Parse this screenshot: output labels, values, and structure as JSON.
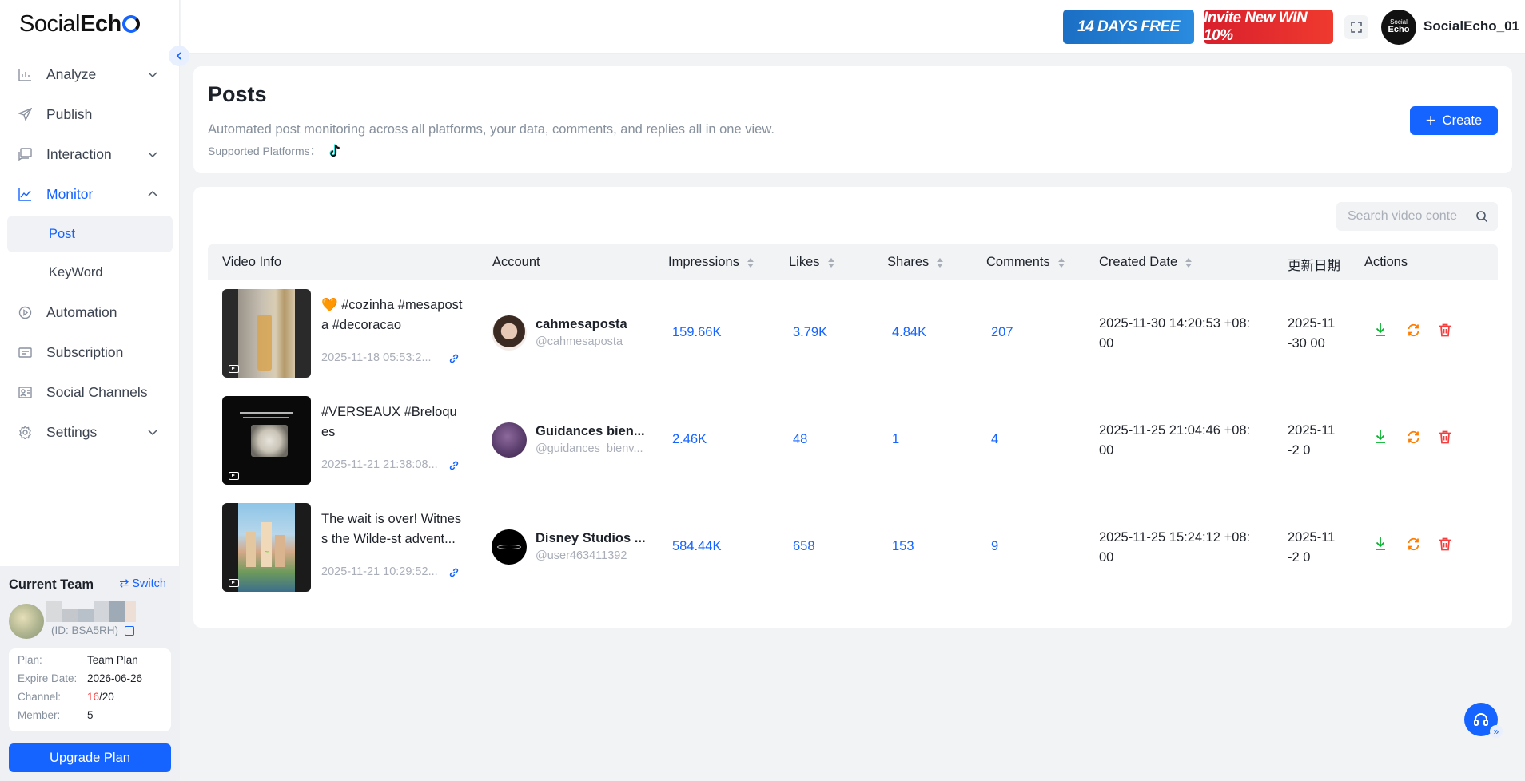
{
  "app": {
    "logo_text_light": "Social",
    "logo_text_bold": "Ech",
    "logo_text_end": "o"
  },
  "sidebar": {
    "items": [
      {
        "label": "Analyze",
        "icon": "bar-chart-icon",
        "expandable": true
      },
      {
        "label": "Publish",
        "icon": "send-icon",
        "expandable": false
      },
      {
        "label": "Interaction",
        "icon": "message-icon",
        "expandable": true
      },
      {
        "label": "Monitor",
        "icon": "monitor-chart-icon",
        "expandable": true,
        "expanded": true
      },
      {
        "label": "Automation",
        "icon": "automation-icon",
        "expandable": false
      },
      {
        "label": "Subscription",
        "icon": "subscription-icon",
        "expandable": false
      },
      {
        "label": "Social Channels",
        "icon": "channels-icon",
        "expandable": false
      },
      {
        "label": "Settings",
        "icon": "gear-icon",
        "expandable": true
      }
    ],
    "monitor_sub": [
      "Post",
      "KeyWord"
    ],
    "selected_sub": "Post"
  },
  "team": {
    "heading": "Current Team",
    "switch_label": "Switch",
    "id_text": "(ID: BSA5RH)",
    "plan_label": "Plan:",
    "plan_value": "Team Plan",
    "expire_label": "Expire Date:",
    "expire_value": "2026-06-26",
    "channel_label": "Channel:",
    "channel_used": "16",
    "channel_total": "/20",
    "member_label": "Member:",
    "member_value": "5",
    "upgrade_label": "Upgrade Plan"
  },
  "topbar": {
    "promo1": "14 DAYS FREE",
    "promo2": "Invite New WIN 10%",
    "user_avatar_text_1": "Social",
    "user_avatar_text_2": "Echo",
    "user_name": "SocialEcho_01"
  },
  "header": {
    "title": "Posts",
    "description": "Automated post monitoring across all platforms, your data, comments, and replies all in one view.",
    "platforms_label": "Supported Platforms：",
    "create_label": "Create"
  },
  "search": {
    "placeholder": "Search video conte"
  },
  "table": {
    "columns": [
      "Video Info",
      "Account",
      "Impressions",
      "Likes",
      "Shares",
      "Comments",
      "Created Date",
      "更新日期",
      "Actions"
    ],
    "rows": [
      {
        "post_text": "🧡 #cozinha #mesaposta #decoracao",
        "post_date": "2025-11-18 05:53:2...",
        "account_name": "cahmesaposta",
        "account_handle": "@cahmesaposta",
        "impressions": "159.66K",
        "likes": "3.79K",
        "shares": "4.84K",
        "comments": "207",
        "created_date": "2025-11-30 14:20:53 +08:00",
        "updated_date": "2025-11-30 00"
      },
      {
        "post_text": "#VERSEAUX #Breloques",
        "post_date": "2025-11-21 21:38:08...",
        "account_name": "Guidances bien...",
        "account_handle": "@guidances_bienv...",
        "impressions": "2.46K",
        "likes": "48",
        "shares": "1",
        "comments": "4",
        "created_date": "2025-11-25 21:04:46 +08:00",
        "updated_date": "2025-11-2 0"
      },
      {
        "post_text": "The wait is over! Witness the Wilde-st advent...",
        "post_date": "2025-11-21 10:29:52...",
        "account_name": "Disney Studios ...",
        "account_handle": "@user463411392",
        "impressions": "584.44K",
        "likes": "658",
        "shares": "153",
        "comments": "9",
        "created_date": "2025-11-25 15:24:12 +08:00",
        "updated_date": "2025-11-2 0"
      }
    ],
    "actions": [
      "download-icon",
      "refresh-icon",
      "delete-icon"
    ]
  },
  "colors": {
    "accent": "#1664ff",
    "download": "#00b42a",
    "refresh": "#ff7d00",
    "delete": "#f53f3f"
  }
}
